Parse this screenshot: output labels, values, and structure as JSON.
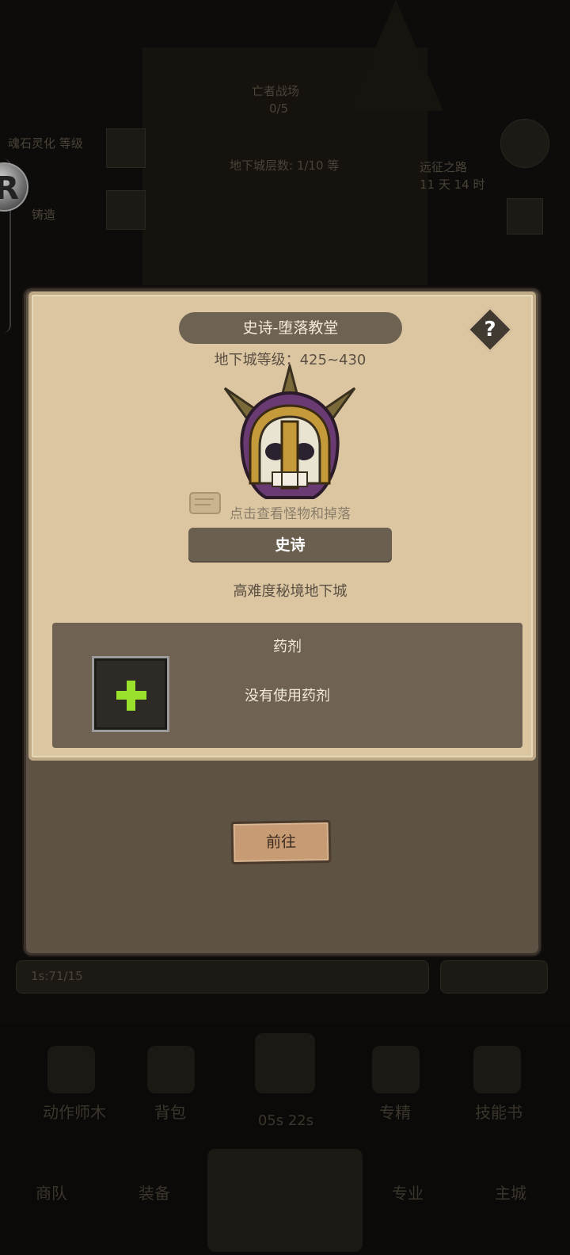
{
  "background": {
    "event_title": "亡者战场",
    "event_sub": "0/5",
    "left_info_1": "魂石灵化 等级",
    "left_info_2": "铸造",
    "center_info": "地下城层数: 1/10 等",
    "right_info": "远征之路",
    "right_info_2": "11 天 14 时",
    "bottom_input": "1s:71/15",
    "nav_row1": [
      "动作师木",
      "背包",
      "05s 22s",
      "专精",
      "技能书"
    ],
    "nav_row2": [
      "商队",
      "装备",
      "",
      "专业",
      "主城"
    ]
  },
  "dialog": {
    "title": "史诗-堕落教堂",
    "help_label": "?",
    "level_label": "地下城等级：425~430",
    "hint": "点击查看怪物和掉落",
    "difficulty_button": "史诗",
    "description": "高难度秘境地下城",
    "potion": {
      "title": "药剂",
      "slot_icon": "plus-icon",
      "empty_text": "没有使用药剂"
    },
    "go_button": "前往"
  },
  "colors": {
    "panel_bg": "#dcc6a2",
    "frame": "#5d5244",
    "accent_green": "#9be12c"
  }
}
